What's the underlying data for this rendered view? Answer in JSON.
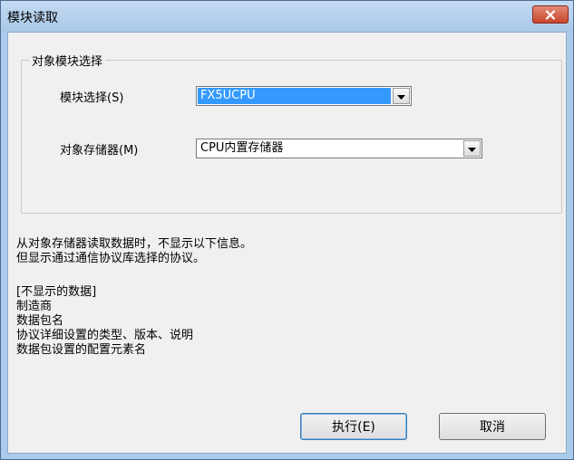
{
  "window": {
    "title": "模块读取"
  },
  "group": {
    "legend": "对象模块选择",
    "module_label": "模块选择(S)",
    "module_value": "FX5UCPU",
    "memory_label": "对象存储器(M)",
    "memory_value": "CPU内置存储器"
  },
  "info": {
    "lines": [
      "从对象存储器读取数据时，不显示以下信息。",
      "但显示通过通信协议库选择的协议。",
      "",
      "[不显示的数据]",
      "制造商",
      "数据包名",
      "协议详细设置的类型、版本、说明",
      "数据包设置的配置元素名"
    ]
  },
  "buttons": {
    "execute": "执行(E)",
    "cancel": "取消"
  },
  "icons": {
    "close": "close-icon",
    "dropdown": "chevron-down-icon"
  },
  "colors": {
    "selection": "#3399ff",
    "close_button": "#c8442b",
    "titlebar": "#aacbea"
  }
}
